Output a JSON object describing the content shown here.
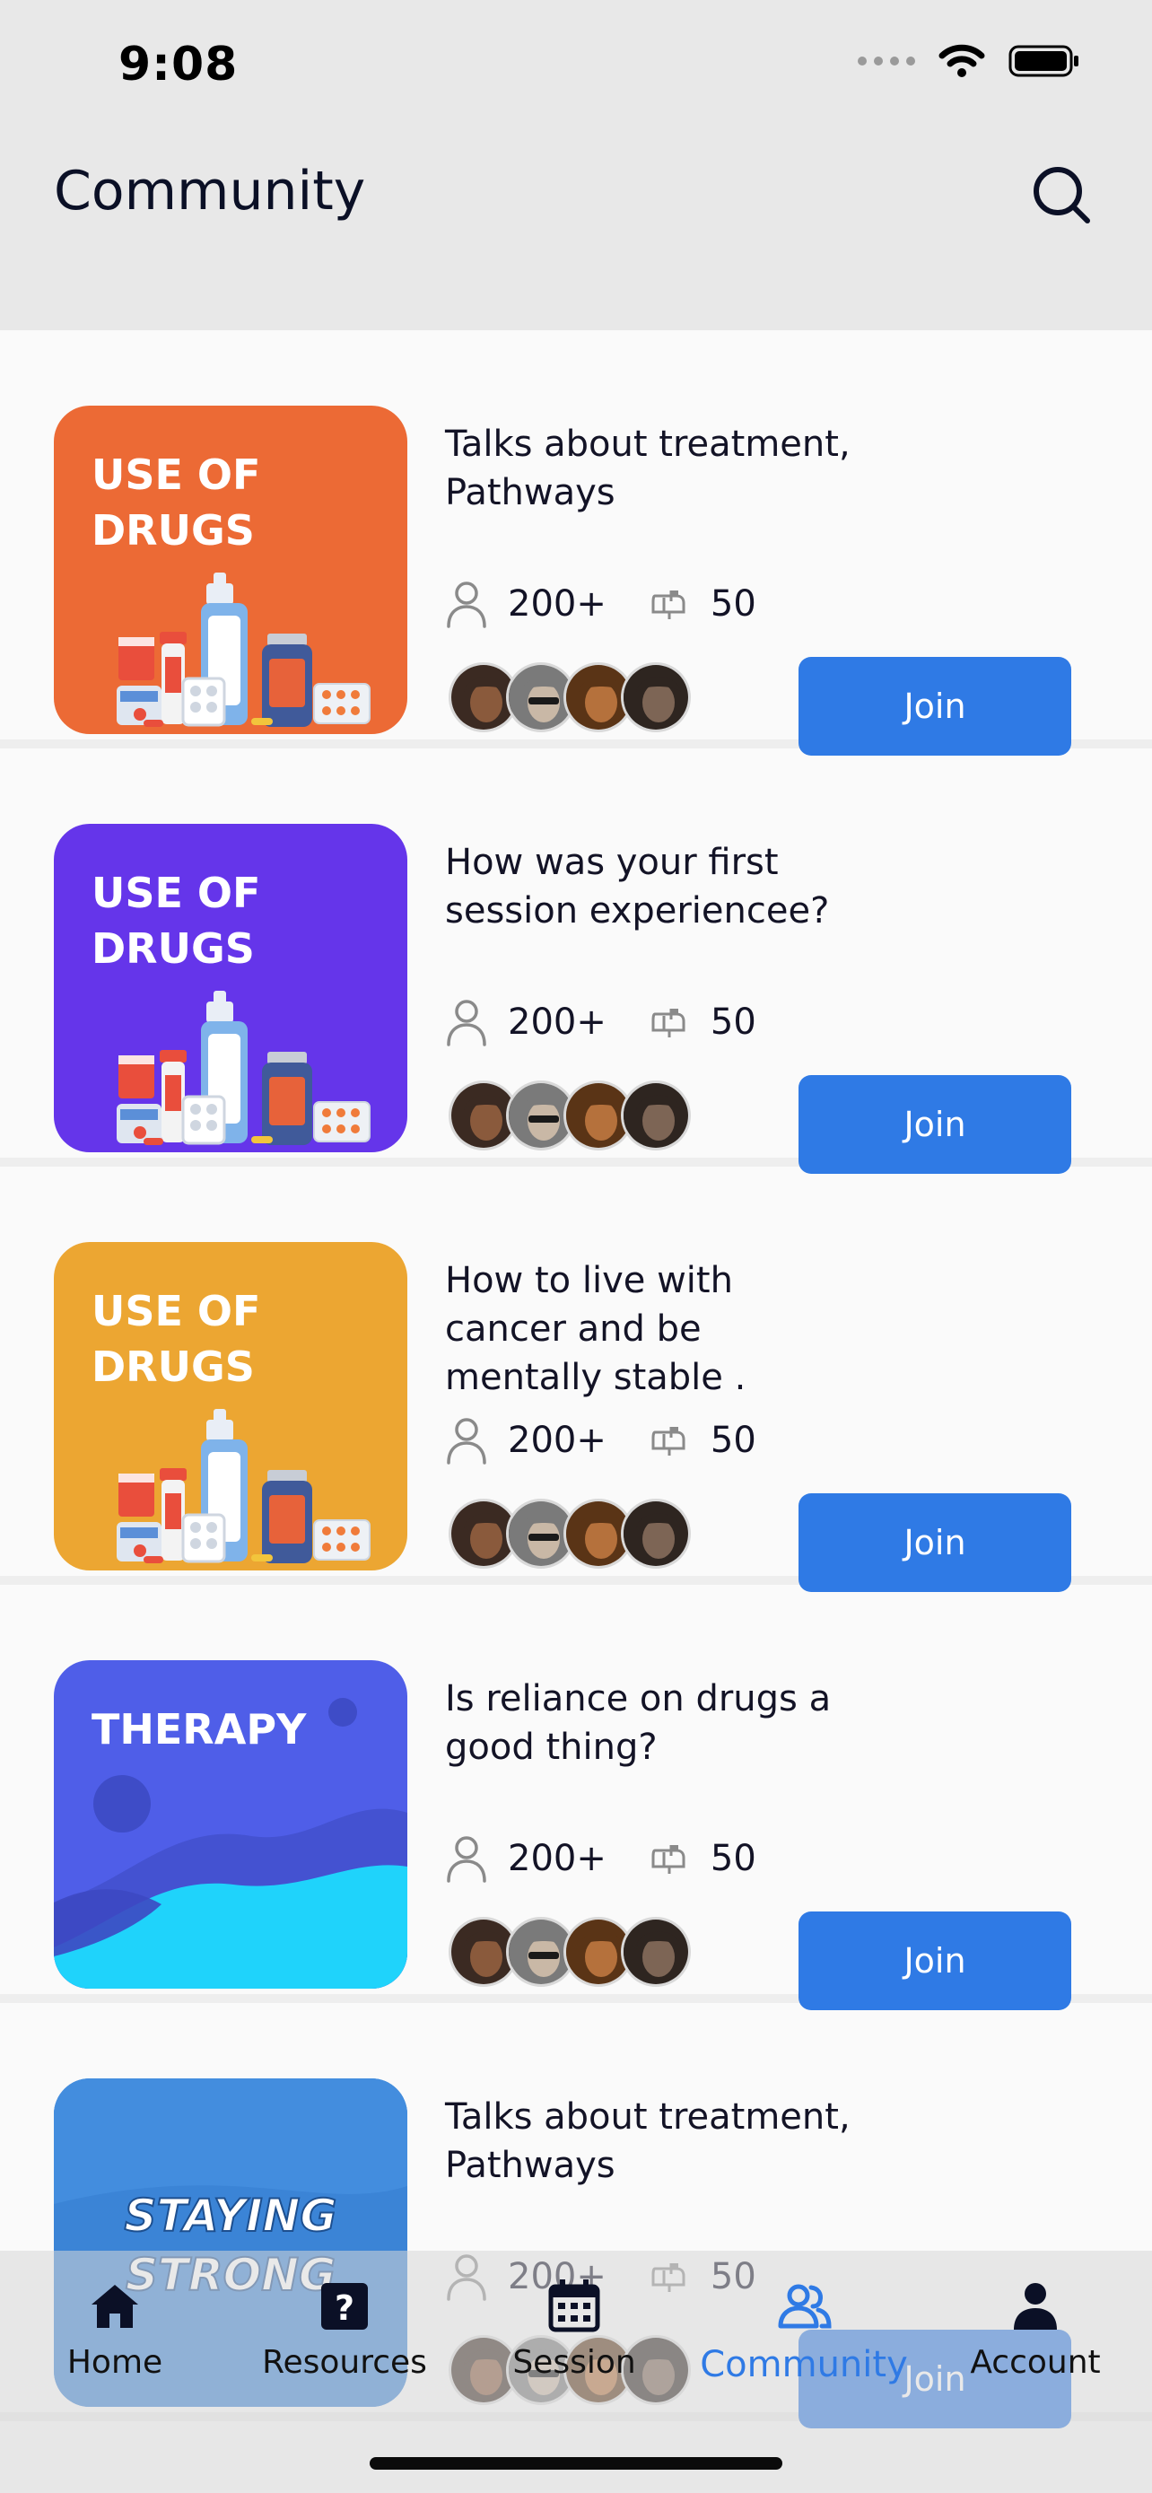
{
  "status_bar": {
    "time": "9:08"
  },
  "header": {
    "title": "Community"
  },
  "colors": {
    "accent": "#2f7ae5",
    "orange": "#ec6a35",
    "purple": "#6535ea",
    "yellow": "#eca632",
    "indigo": "#4f5ee8",
    "blue": "#3b84d6"
  },
  "cards": [
    {
      "thumb_title": "USE OF DRUGS",
      "thumb_style": "drugs",
      "thumb_color": "#ec6a35",
      "title": "Talks about treatment, Pathways",
      "members": "200+",
      "messages": "50",
      "join_label": "Join"
    },
    {
      "thumb_title": "USE OF DRUGS",
      "thumb_style": "drugs",
      "thumb_color": "#6535ea",
      "title": "How was your first session experiencee?",
      "members": "200+",
      "messages": "50",
      "join_label": "Join"
    },
    {
      "thumb_title": "USE OF DRUGS",
      "thumb_style": "drugs",
      "thumb_color": "#eca632",
      "title": "How to live with cancer and be mentally stable .",
      "members": "200+",
      "messages": "50",
      "join_label": "Join"
    },
    {
      "thumb_title": "THERAPY",
      "thumb_style": "therapy",
      "thumb_color": "#4f5ee8",
      "title": "Is reliance on drugs a good thing?",
      "members": "200+",
      "messages": "50",
      "join_label": "Join"
    },
    {
      "thumb_title": "STAYING STRONG",
      "thumb_style": "strong",
      "thumb_color": "#3b84d6",
      "title": "Talks about treatment, Pathways",
      "members": "200+",
      "messages": "50",
      "join_label": "Join"
    }
  ],
  "tabs": [
    {
      "label": "Home",
      "icon": "home-icon"
    },
    {
      "label": "Resources",
      "icon": "question-icon"
    },
    {
      "label": "Session",
      "icon": "calendar-icon"
    },
    {
      "label": "Community",
      "icon": "people-icon",
      "active": true
    },
    {
      "label": "Account",
      "icon": "person-icon"
    }
  ]
}
